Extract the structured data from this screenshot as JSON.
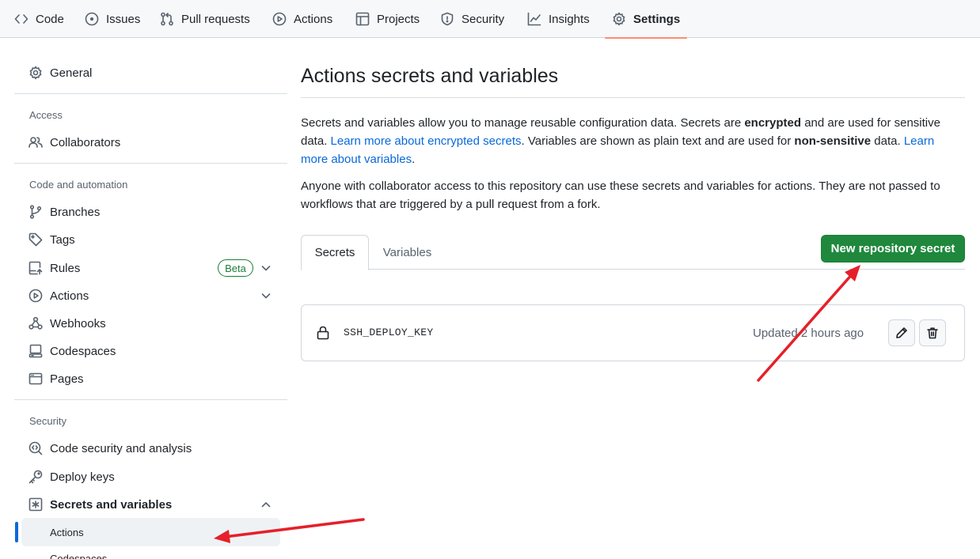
{
  "repo_nav": {
    "tabs": [
      {
        "label": "Code",
        "icon": "code-icon"
      },
      {
        "label": "Issues",
        "icon": "issue-opened-icon"
      },
      {
        "label": "Pull requests",
        "icon": "git-pull-request-icon"
      },
      {
        "label": "Actions",
        "icon": "play-icon"
      },
      {
        "label": "Projects",
        "icon": "table-icon"
      },
      {
        "label": "Security",
        "icon": "shield-icon"
      },
      {
        "label": "Insights",
        "icon": "graph-icon"
      },
      {
        "label": "Settings",
        "icon": "gear-icon"
      }
    ],
    "active_tab": "Settings",
    "active_underline_color": "#fd8c73"
  },
  "sidebar": {
    "general": "General",
    "access_heading": "Access",
    "collaborators": "Collaborators",
    "code_heading": "Code and automation",
    "branches": "Branches",
    "tags": "Tags",
    "rules": "Rules",
    "rules_badge": "Beta",
    "actions": "Actions",
    "webhooks": "Webhooks",
    "codespaces": "Codespaces",
    "pages": "Pages",
    "security_heading": "Security",
    "code_security": "Code security and analysis",
    "deploy_keys": "Deploy keys",
    "secrets_and_variables": "Secrets and variables",
    "sub_actions": "Actions",
    "sub_codespaces": "Codespaces"
  },
  "main": {
    "title": "Actions secrets and variables",
    "intro": {
      "t1": "Secrets and variables allow you to manage reusable configuration data. Secrets are ",
      "b1": "encrypted",
      "t2": " and are used for sensitive data. ",
      "link1": "Learn more about encrypted secrets",
      "t3": ". Variables are shown as plain text and are used for ",
      "b2": "non-sensitive",
      "t4": " data. ",
      "link2": "Learn more about variables",
      "t5": "."
    },
    "notice": "Anyone with collaborator access to this repository can use these secrets and variables for actions. They are not passed to workflows that are triggered by a pull request from a fork.",
    "tabs": [
      "Secrets",
      "Variables"
    ],
    "selected_tab": "Secrets",
    "new_button": "New repository secret",
    "secrets": [
      {
        "name": "SSH_DEPLOY_KEY",
        "updated": "Updated 2 hours ago"
      }
    ]
  },
  "colors": {
    "primary_button": "#1f883d",
    "link": "#0969da",
    "annotation_arrow": "#e5202a"
  }
}
